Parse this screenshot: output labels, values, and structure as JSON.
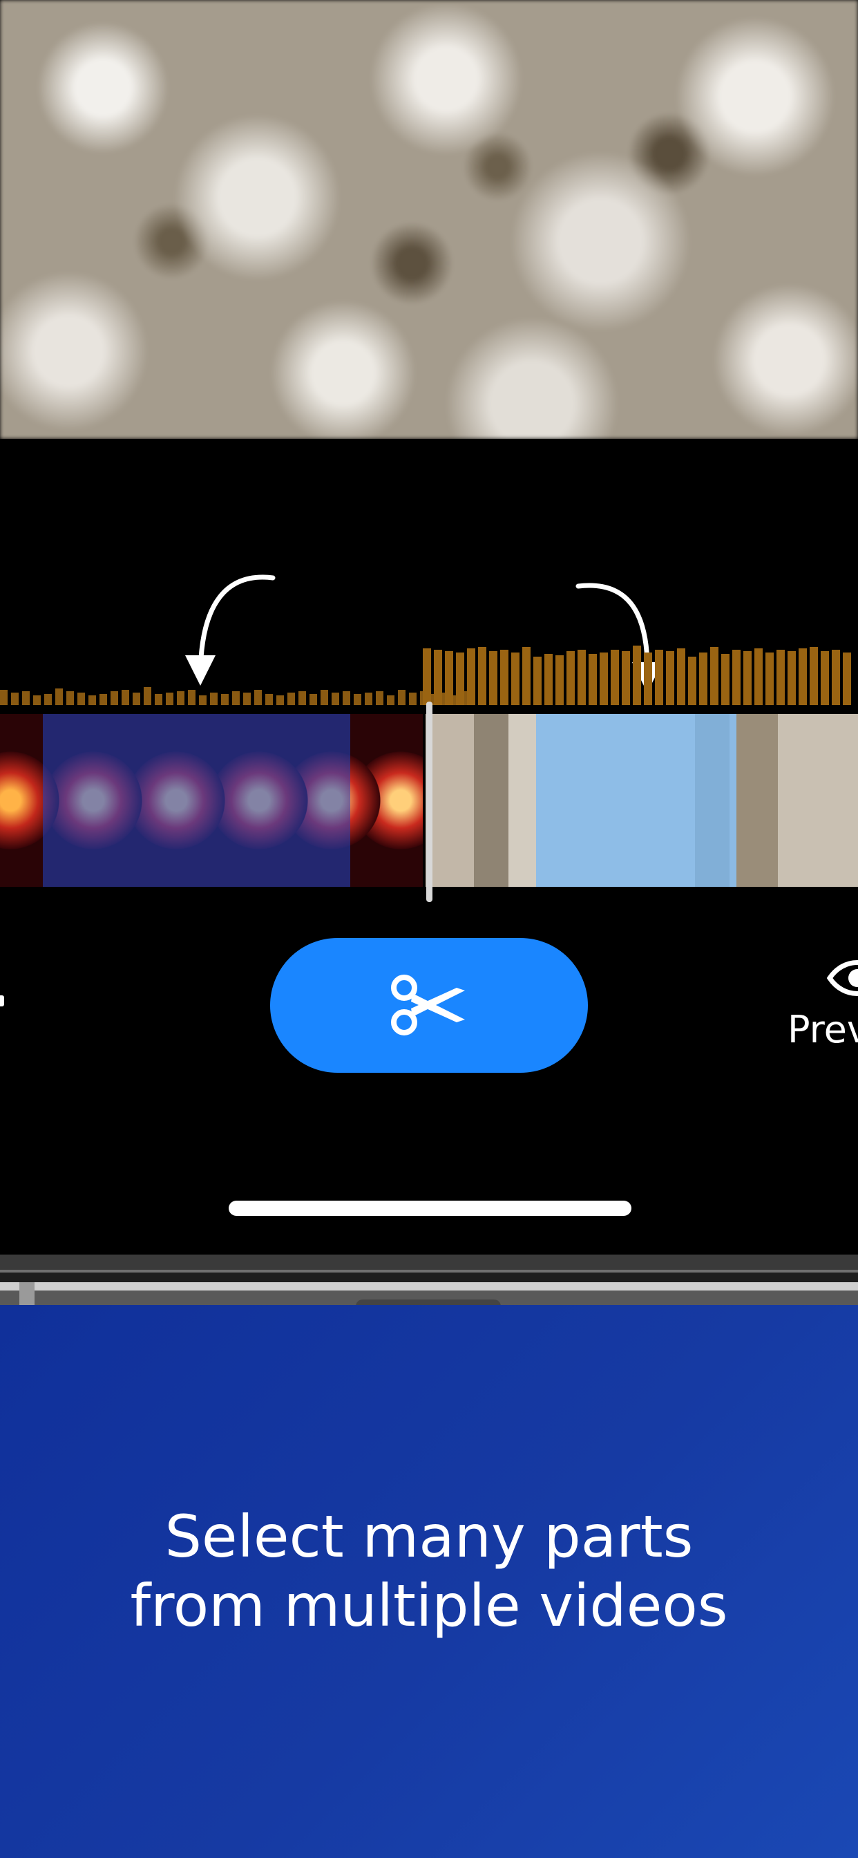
{
  "editor": {
    "cut_icon": "scissors-icon",
    "preview_icon": "eye-icon",
    "preview_label": "Prev"
  },
  "caption": {
    "line1": "Select many parts",
    "line2": "from multiple videos"
  },
  "colors": {
    "accent": "#1a86ff",
    "caption_bg": "#1238a0",
    "waveform": "#8a5a12"
  }
}
